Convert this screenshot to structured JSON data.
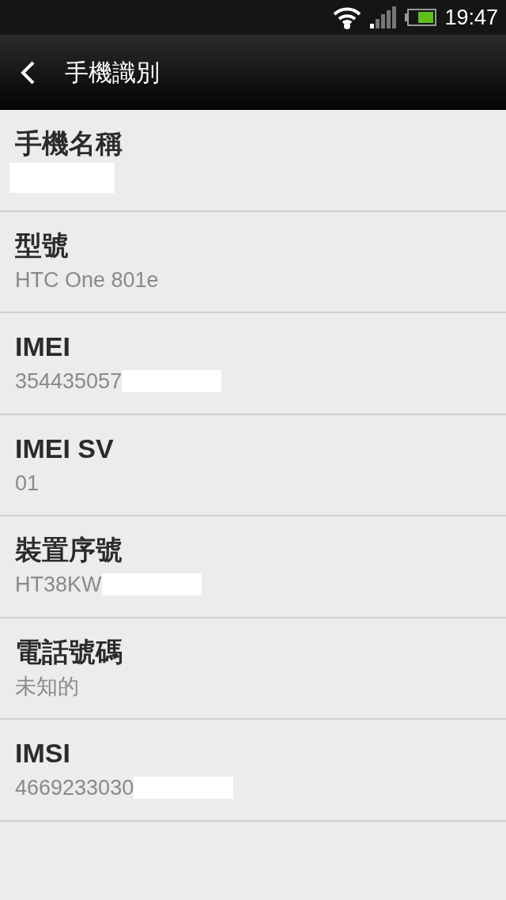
{
  "status_bar": {
    "time": "19:47"
  },
  "header": {
    "title": "手機識別"
  },
  "rows": [
    {
      "label": "手機名稱",
      "redacted": true
    },
    {
      "label": "型號",
      "value": "HTC One 801e",
      "redacted": false
    },
    {
      "label": "IMEI",
      "value": "354435057",
      "redacted": true
    },
    {
      "label": "IMEI SV",
      "value": "01",
      "redacted": false
    },
    {
      "label": "裝置序號",
      "value": "HT38KW",
      "redacted": true
    },
    {
      "label": "電話號碼",
      "value": "未知的",
      "redacted": false
    },
    {
      "label": "IMSI",
      "value": "4669233030",
      "redacted": true
    }
  ]
}
